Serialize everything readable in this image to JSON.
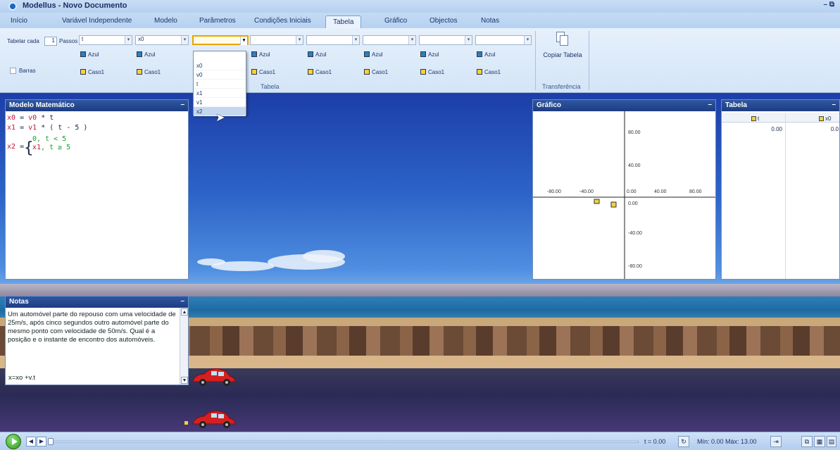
{
  "app": {
    "title": "Modellus - Novo Documento",
    "window_controls": "– ⧉"
  },
  "tabs": [
    "Início",
    "Variável Independente",
    "Modelo",
    "Parâmetros",
    "Condições Iniciais",
    "Tabela",
    "Gráfico",
    "Objectos",
    "Notas"
  ],
  "ribbon": {
    "tabelar_label": "Tabelar cada",
    "tabelar_value": "1",
    "passos_label": "Passos",
    "barras_label": "Barras",
    "combo_values": [
      "t",
      "x0",
      "",
      "",
      "",
      "",
      "",
      "",
      ""
    ],
    "color_label": "Azul",
    "case_label": "Caso1",
    "group_label": "Tabela",
    "copy_label": "Copiar Tabela",
    "transfer_label": "Transferência"
  },
  "dropdown": {
    "items": [
      "x0",
      "v0",
      "t",
      "x1",
      "v1",
      "x2"
    ],
    "selected_index": 5
  },
  "model_panel": {
    "title": "Modelo Matemático",
    "eq1_lhs": "x0",
    "eq1_rhs_var": "v0",
    "eq1_rest": "* t",
    "eq2_lhs": "x1",
    "eq2_rhs_var": "v1",
    "eq2_rest": "* ( t - 5 )",
    "eq3_lhs": "x2",
    "eq3_case1_val": "0",
    "eq3_case1_cond": ", t < 5",
    "eq3_case2_val": "x1",
    "eq3_case2_cond": ", t ≥ 5"
  },
  "notes_panel": {
    "title": "Notas",
    "text": "Um automóvel parte do repouso com uma velocidade de 25m/s, após cinco segundos outro automóvel parte do mesmo ponto com velocidade de 50m/s. Qual é a posição e o instante de encontro dos automóveis.",
    "formula": "x=xo +v.t"
  },
  "graph_panel": {
    "title": "Gráfico",
    "x_ticks": [
      "-80.00",
      "-40.00",
      "0.00",
      "40.00",
      "80.00"
    ],
    "y_ticks": [
      "80.00",
      "40.00",
      "0.00",
      "-40.00",
      "-80.00"
    ]
  },
  "table_panel": {
    "title": "Tabela",
    "columns": [
      "t",
      "x0"
    ],
    "row": [
      "0.00",
      "0.0"
    ]
  },
  "bottom": {
    "t_readout": "t = 0.00",
    "min_max": "Mín: 0.00 Máx: 13.00"
  },
  "colors": {
    "accent": "#1e3d80",
    "highlight": "#e8a400",
    "car": "#d42020"
  }
}
